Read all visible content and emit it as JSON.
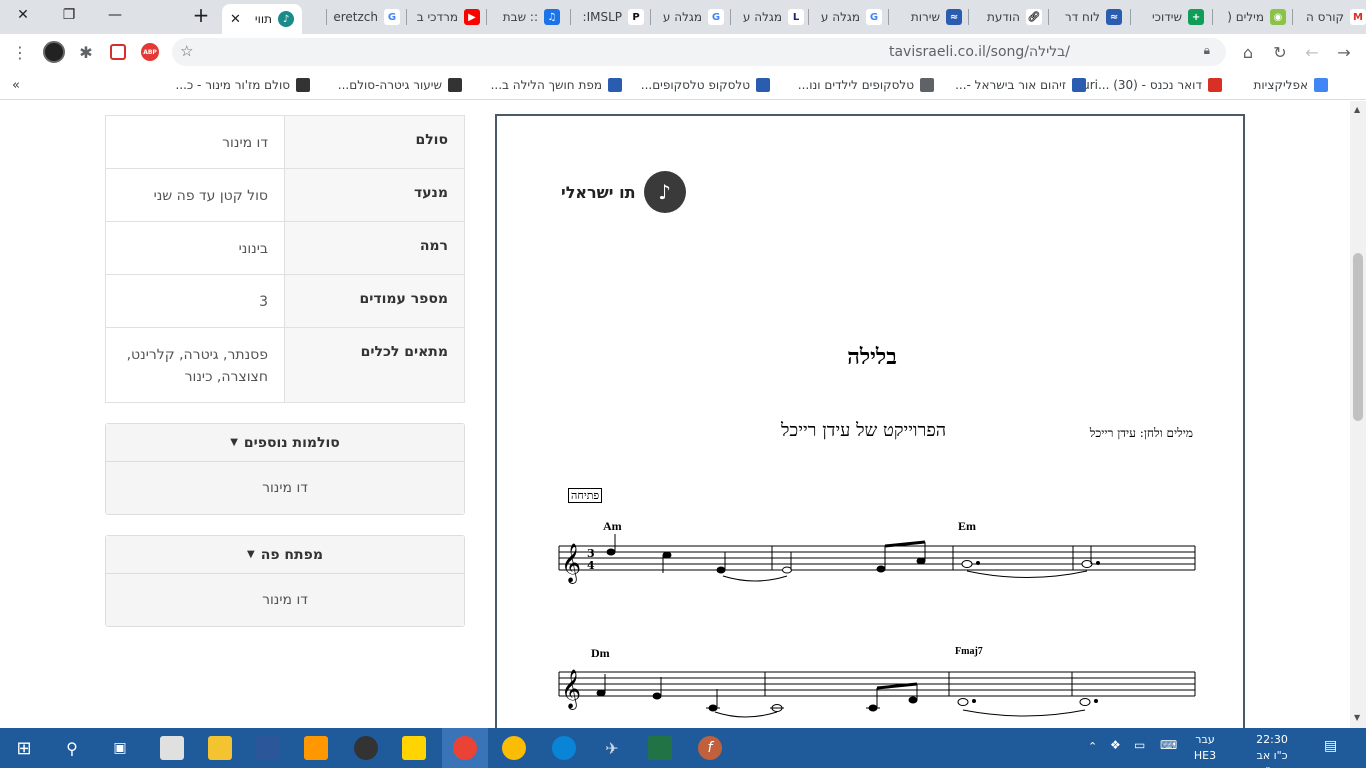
{
  "tabs": [
    {
      "label": "קורס ה",
      "icon": "gmail-icon",
      "color": "#ffffff"
    },
    {
      "label": "מילים (",
      "icon": "lime-icon",
      "color": "#8bc34a"
    },
    {
      "label": "שידוכי",
      "icon": "plus-green-icon",
      "color": "#0f9d58"
    },
    {
      "label": "לוח דר",
      "icon": "site-icon",
      "color": "#2a5db0"
    },
    {
      "label": "הודעת",
      "icon": "link-icon",
      "color": "#ffffff"
    },
    {
      "label": "שירות",
      "icon": "site-icon",
      "color": "#2a5db0"
    },
    {
      "label": "מגלה ע",
      "icon": "google-icon",
      "color": "#ffffff"
    },
    {
      "label": "מגלה ע",
      "icon": "l-icon",
      "color": "#ffffff"
    },
    {
      "label": "מגלה ע",
      "icon": "google-icon",
      "color": "#ffffff"
    },
    {
      "label": "IMSLP:",
      "icon": "imslp-icon",
      "color": "#ffffff"
    },
    {
      "label": ":: שבת",
      "icon": "music-icon",
      "color": "#1a73e8"
    },
    {
      "label": "מרדכי ב",
      "icon": "youtube-icon",
      "color": "#ff0000"
    },
    {
      "label": "eretzch",
      "icon": "google-icon",
      "color": "#ffffff"
    }
  ],
  "active_tab": {
    "label": "תווי"
  },
  "url": "tavisraeli.co.il/song/בלילה/",
  "bookmarks": [
    {
      "label": "אפליקציות"
    },
    {
      "label": "דואר נכנס - uri... (30)"
    },
    {
      "label": "זיהום אור בישראל -..."
    },
    {
      "label": "טלסקופים לילדים ונו..."
    },
    {
      "label": "טלסקופ טלסקופים..."
    },
    {
      "label": "מפת חושך הלילה ב..."
    },
    {
      "label": "שיעור גיטרה-סולם..."
    },
    {
      "label": "סולם מז'ור מינור - כ..."
    }
  ],
  "info": [
    {
      "label": "סולם",
      "value": "דו מינור"
    },
    {
      "label": "מנעד",
      "value": "סול קטן עד פה שני"
    },
    {
      "label": "רמה",
      "value": "בינוני"
    },
    {
      "label": "מספר עמודים",
      "value": "3"
    },
    {
      "label": "מתאים לכלים",
      "value": "פסנתר, גיטרה, קלרינט, חצוצרה, כינור"
    }
  ],
  "panels": [
    {
      "title": "סולמות נוספים",
      "value": "דו מינור"
    },
    {
      "title": "מפתח פה",
      "value": "דו מינור"
    }
  ],
  "sheet": {
    "brand": "תו ישראלי",
    "title": "בלילה",
    "project": "הפרוייקט של עידן רייכל",
    "credits": "מילים ולחן: עידן רייכל",
    "section": "פתיחה",
    "time_signature": "3/4",
    "chords_row1": [
      "Am",
      "Em"
    ],
    "chords_row2": [
      "Dm",
      "Fmaj7"
    ]
  },
  "taskbar": {
    "time": "22:30",
    "date": "כ\"ו אב תש\"פ",
    "lang": "עבר",
    "lang2": "HE3"
  }
}
